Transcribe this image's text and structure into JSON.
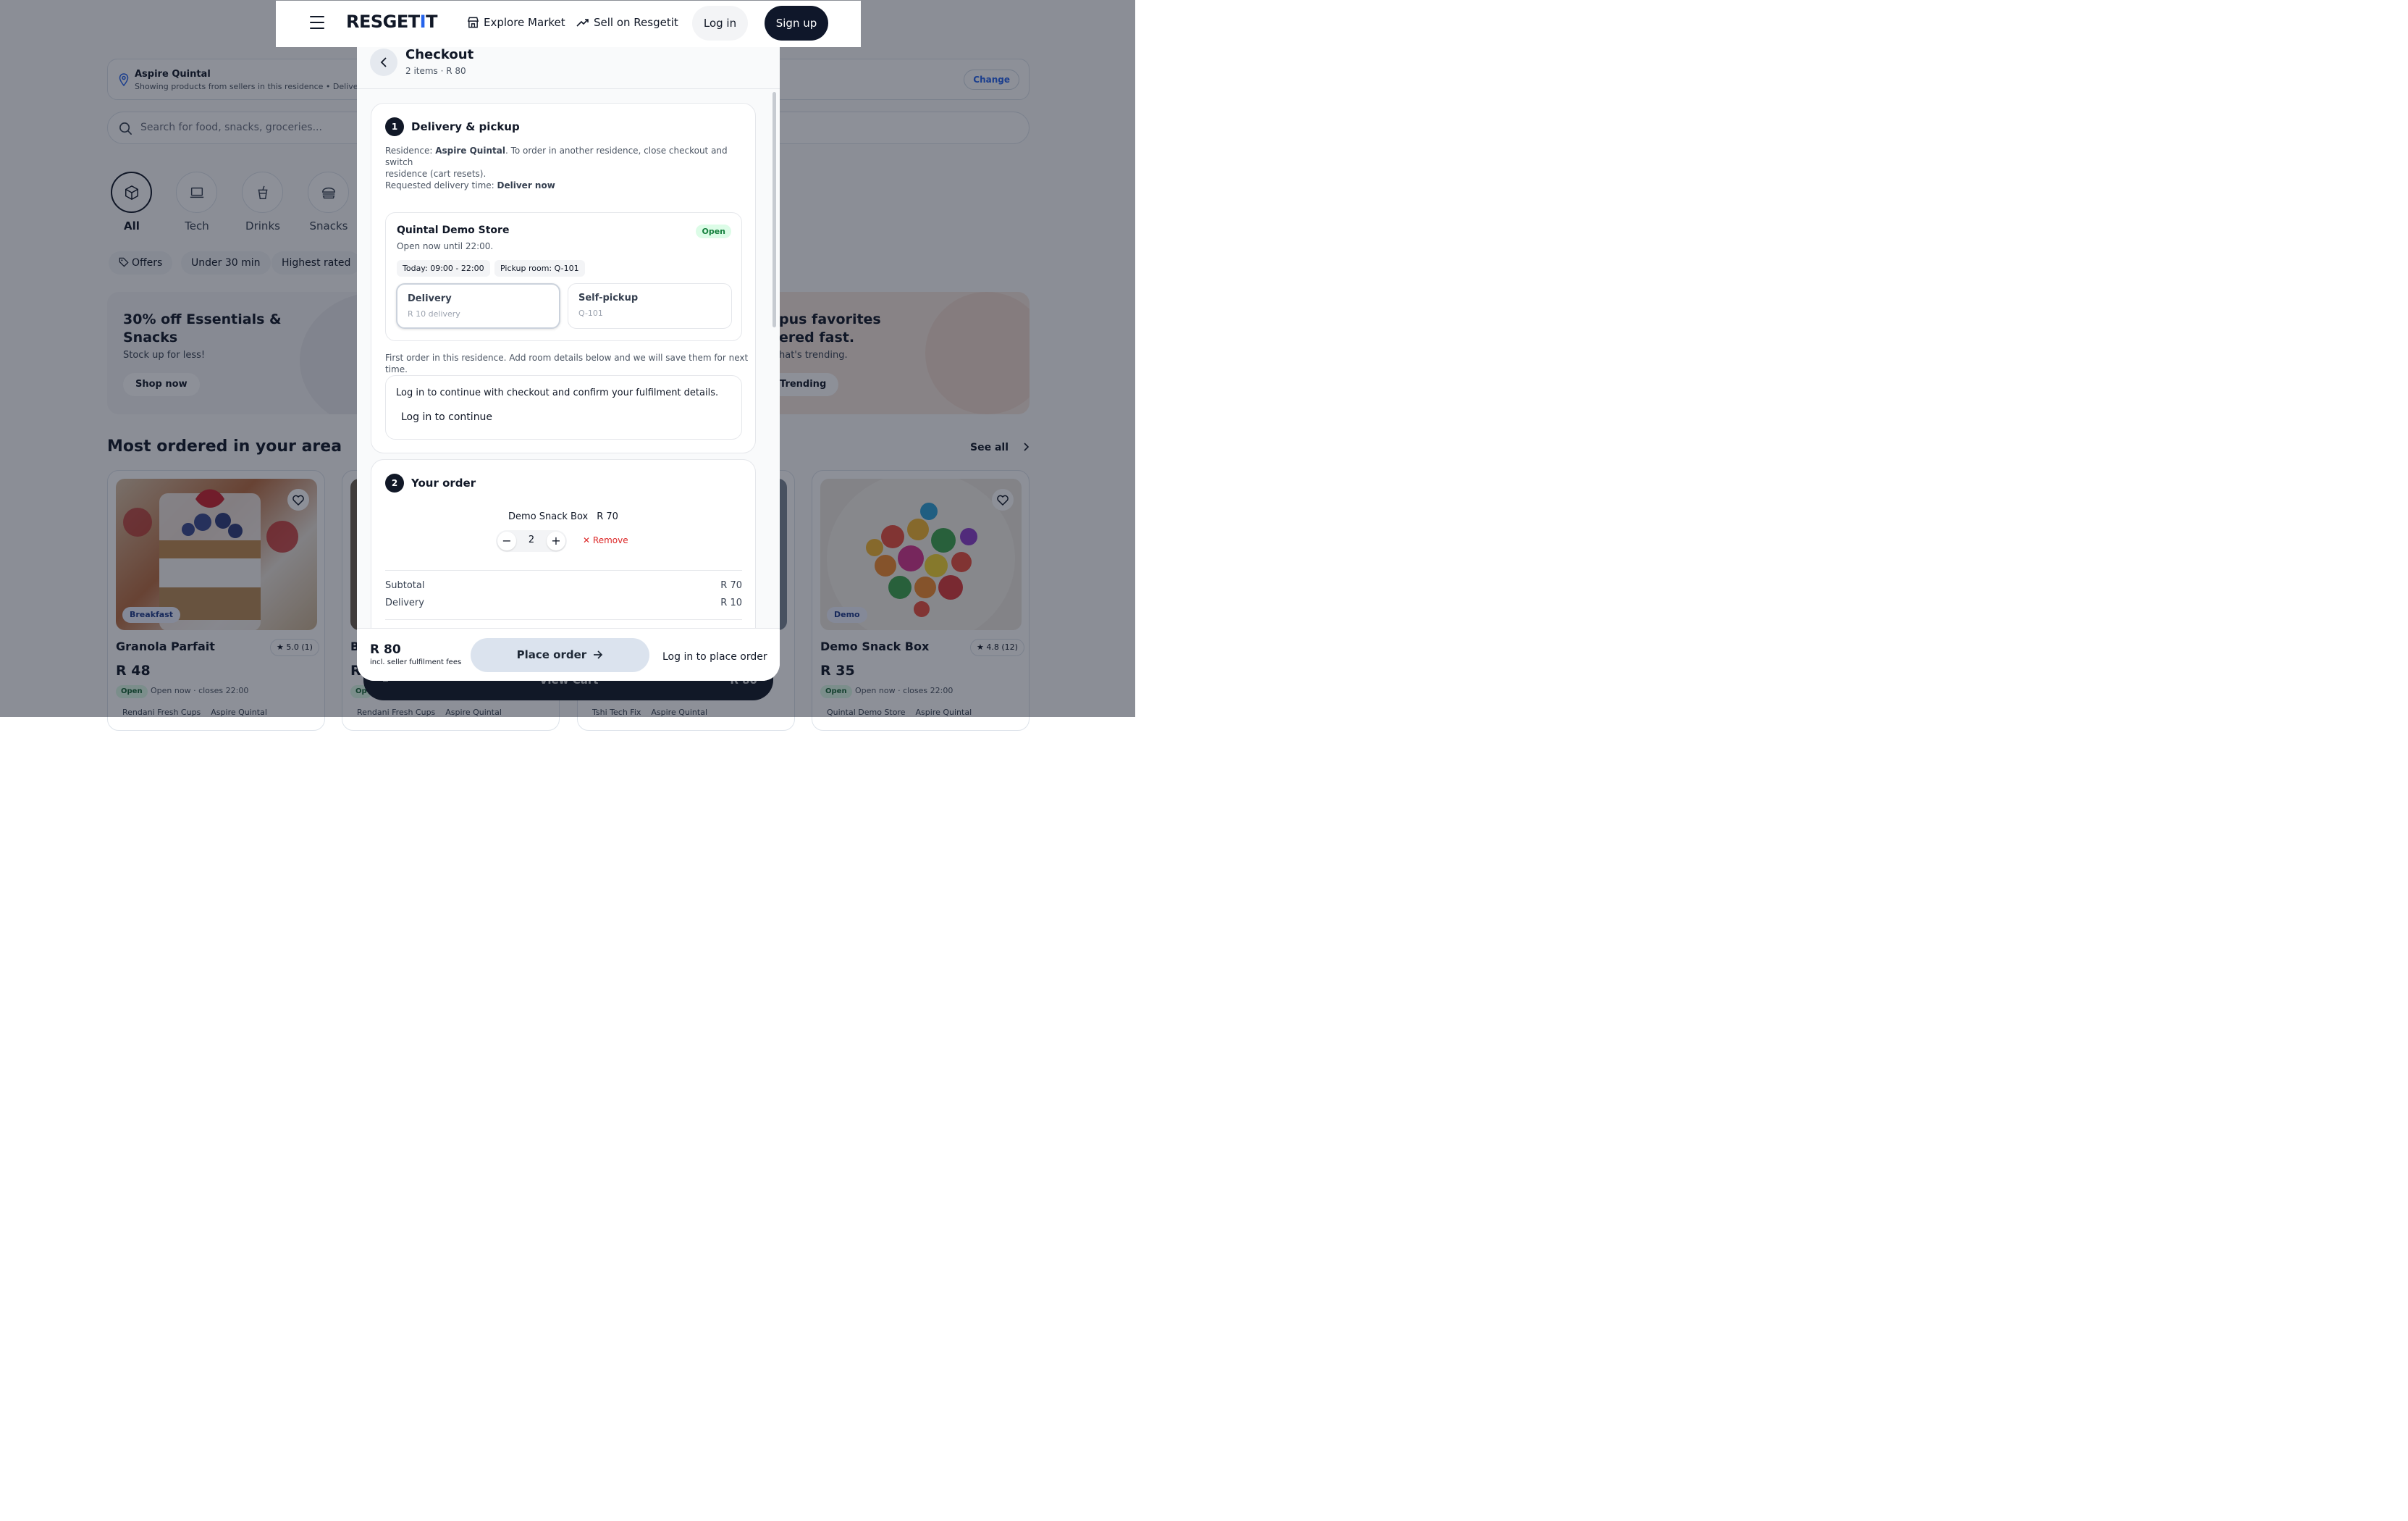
{
  "nav": {
    "logo_main": "RESGET",
    "logo_accent": "I",
    "logo_end": "T",
    "explore": "Explore Market",
    "sell": "Sell on Resgetit",
    "login": "Log in",
    "signup": "Sign up"
  },
  "location": {
    "name": "Aspire Quintal",
    "sub": "Showing products from sellers in this residence  •  Deliver n",
    "change": "Change"
  },
  "search": {
    "placeholder": "Search for food, snacks, groceries..."
  },
  "categories": [
    {
      "label": "All",
      "icon": "box-icon"
    },
    {
      "label": "Tech",
      "icon": "laptop-icon"
    },
    {
      "label": "Drinks",
      "icon": "cup-icon"
    },
    {
      "label": "Snacks",
      "icon": "burger-icon"
    }
  ],
  "filters": [
    "Offers",
    "Under 30 min",
    "Highest rated"
  ],
  "promos": {
    "left": {
      "title_1": "30% off Essentials &",
      "title_2": "Snacks",
      "sub": "Stock up for less!",
      "button": "Shop now"
    },
    "right": {
      "title_1": "pus favorites",
      "title_2": "ered fast.",
      "sub": "hat's trending.",
      "button": "Trending"
    }
  },
  "section": {
    "title": "Most ordered in your area",
    "see_all": "See all"
  },
  "cards": [
    {
      "tag": "Breakfast",
      "title": "Granola Parfait",
      "rating": "5.0 (1)",
      "price": "R 48",
      "open": "Open",
      "hours": "Open now · closes 22:00",
      "store": "Rendani Fresh Cups",
      "residence": "Aspire Quintal"
    },
    {
      "title": "B",
      "price": "R",
      "open": "Op",
      "store": "Rendani Fresh Cups",
      "residence": "Aspire Quintal"
    },
    {
      "store": "Tshi Tech Fix",
      "residence": "Aspire Quintal"
    },
    {
      "tag": "Demo",
      "title": "Demo Snack Box",
      "rating": "4.8 (12)",
      "price": "R 35",
      "open": "Open",
      "hours": "Open now · closes 22:00",
      "store": "Quintal Demo Store",
      "residence": "Aspire Quintal"
    }
  ],
  "view_cart": {
    "count": "2",
    "label": "View Cart",
    "total": "R 80"
  },
  "checkout": {
    "title": "Checkout",
    "subtitle": "2 items · R 80",
    "s1": {
      "num": "1",
      "title": "Delivery & pickup",
      "residence_label": "Residence: ",
      "residence_name": "Aspire Quintal",
      "residence_note_1": ". To order in another residence, close checkout and switch",
      "residence_note_2": "residence (cart resets).",
      "time_label": "Requested delivery time: ",
      "time_value": "Deliver now",
      "store_name": "Quintal Demo Store",
      "store_status": "Open",
      "store_open": "Open now until 22:00.",
      "chip_hours": "Today: 09:00 - 22:00",
      "chip_room": "Pickup room: Q-101",
      "opt_delivery_title": "Delivery",
      "opt_delivery_sub": "R 10 delivery",
      "opt_pickup_title": "Self-pickup",
      "opt_pickup_sub": "Q-101",
      "first_order_note": "First order in this residence. Add room details below and we will save them for next time.",
      "login_text": "Log in to continue with checkout and confirm your fulfilment details.",
      "login_link": "Log in to continue"
    },
    "s2": {
      "num": "2",
      "title": "Your order",
      "item_name": "Demo Snack Box",
      "item_price": "R 70",
      "qty": "2",
      "remove": "Remove",
      "subtotal_label": "Subtotal",
      "subtotal_value": "R 70",
      "delivery_label": "Delivery",
      "delivery_value": "R 10"
    },
    "footer": {
      "total": "R 80",
      "note": "incl. seller fulfilment fees",
      "place_order": "Place order",
      "login_to_place": "Log in to place order"
    }
  },
  "colors": {
    "brand_dark": "#0f172a",
    "accent": "#2563eb",
    "open_green": "#15803d",
    "remove_red": "#dc2626"
  }
}
